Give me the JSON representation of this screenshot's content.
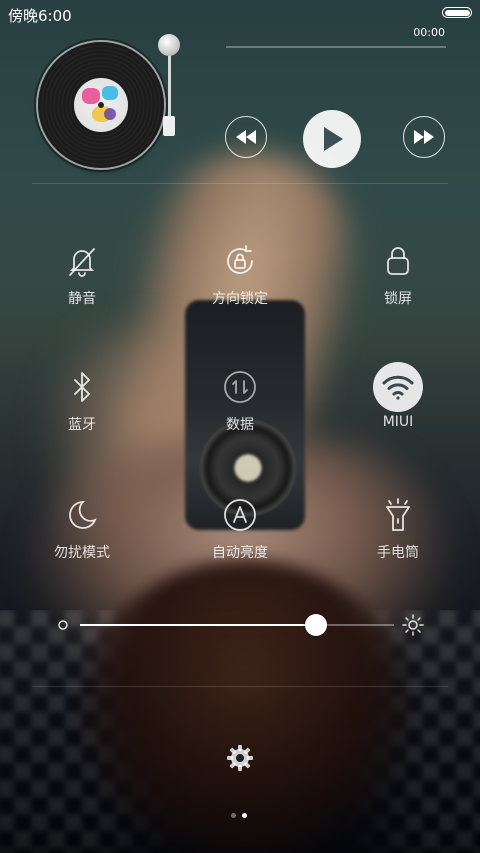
{
  "status_bar": {
    "time": "傍晚6:00"
  },
  "music_player": {
    "elapsed": "00:00",
    "progress_fraction": 0.0
  },
  "toggles": [
    {
      "label": "静音",
      "icon": "bell-off-icon",
      "active": false
    },
    {
      "label": "方向锁定",
      "icon": "rotation-lock-icon",
      "active": false
    },
    {
      "label": "锁屏",
      "icon": "lock-icon",
      "active": false
    },
    {
      "label": "蓝牙",
      "icon": "bluetooth-icon",
      "active": false
    },
    {
      "label": "数据",
      "icon": "mobile-data-icon",
      "active": false
    },
    {
      "label": "MIUI",
      "icon": "wifi-icon",
      "active": true
    },
    {
      "label": "勿扰模式",
      "icon": "moon-icon",
      "active": false
    },
    {
      "label": "自动亮度",
      "icon": "auto-brightness-icon",
      "active": false
    },
    {
      "label": "手电筒",
      "icon": "flashlight-icon",
      "active": false
    }
  ],
  "brightness": {
    "level_fraction": 0.75
  },
  "pager": {
    "page_count": 2,
    "current_page": 2
  },
  "colors": {
    "active_toggle_bg": "#ffffff",
    "active_icon": "#3a4a4c"
  }
}
